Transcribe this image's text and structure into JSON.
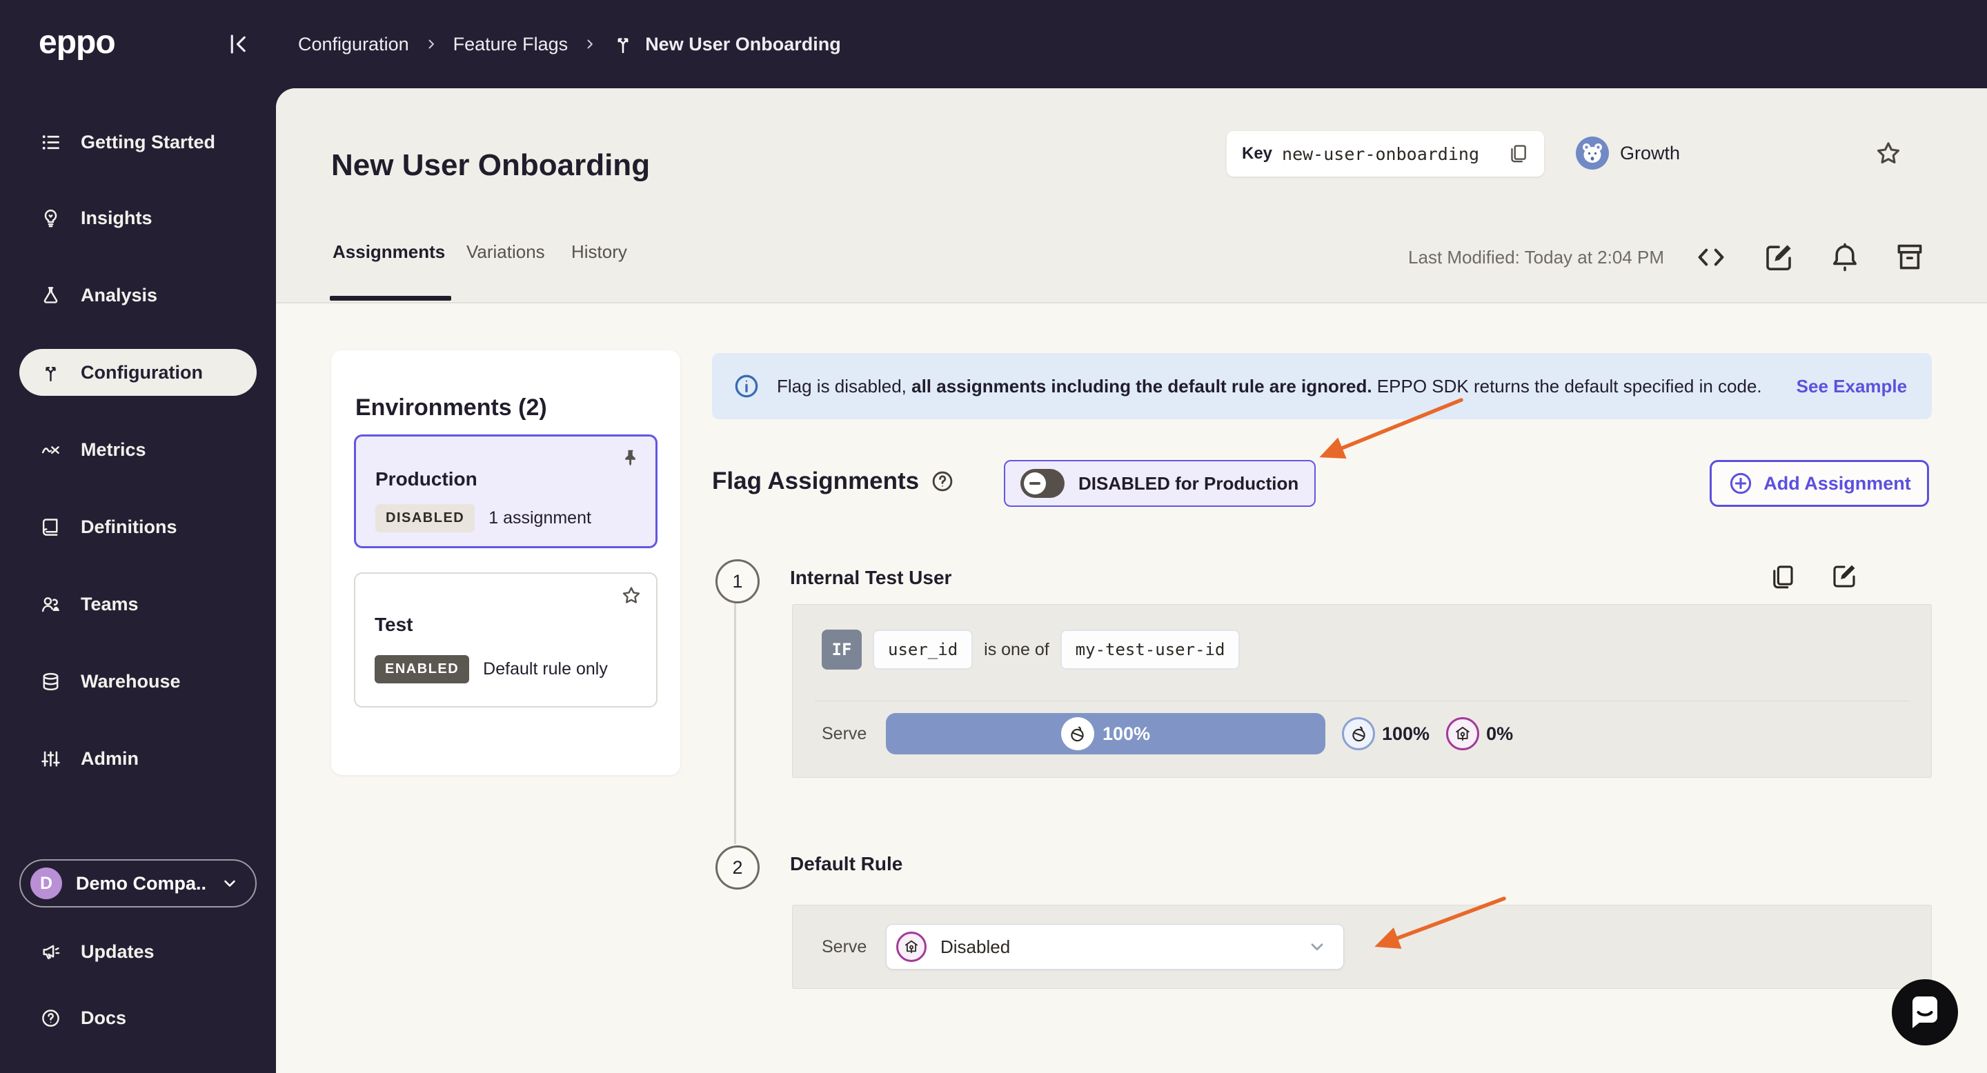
{
  "app": {
    "logo_text": "eppo"
  },
  "breadcrumb": {
    "items": [
      "Configuration",
      "Feature Flags",
      "New User Onboarding"
    ]
  },
  "sidebar": {
    "items": [
      {
        "label": "Getting Started",
        "icon": "list-icon"
      },
      {
        "label": "Insights",
        "icon": "lightbulb-icon"
      },
      {
        "label": "Analysis",
        "icon": "flask-icon"
      },
      {
        "label": "Configuration",
        "icon": "branch-icon",
        "selected": true
      },
      {
        "label": "Metrics",
        "icon": "metrics-icon"
      },
      {
        "label": "Definitions",
        "icon": "book-icon"
      },
      {
        "label": "Teams",
        "icon": "people-icon"
      },
      {
        "label": "Warehouse",
        "icon": "database-icon"
      },
      {
        "label": "Admin",
        "icon": "sliders-icon"
      }
    ],
    "org": {
      "avatar_initial": "D",
      "name": "Demo Compa..."
    },
    "footer_items": [
      {
        "label": "Updates",
        "icon": "megaphone-icon"
      },
      {
        "label": "Docs",
        "icon": "help-icon"
      }
    ]
  },
  "header": {
    "title": "New User Onboarding",
    "key": {
      "label": "Key",
      "value": "new-user-onboarding"
    },
    "team": {
      "name": "Growth"
    },
    "tabs": [
      {
        "label": "Assignments",
        "active": true
      },
      {
        "label": "Variations"
      },
      {
        "label": "History"
      }
    ],
    "last_modified": "Last Modified: Today at 2:04 PM"
  },
  "environments": {
    "title": "Environments (2)",
    "cards": [
      {
        "name": "Production",
        "status": "DISABLED",
        "detail": "1 assignment",
        "pinned": true,
        "selected": true
      },
      {
        "name": "Test",
        "status": "ENABLED",
        "detail": "Default rule only"
      }
    ]
  },
  "banner": {
    "text_normal_1": "Flag is disabled, ",
    "text_bold": "all assignments including the default rule are ignored.",
    "text_normal_2": " EPPO SDK returns the default specified in code.",
    "link_label": "See Example"
  },
  "flag_assignments": {
    "heading": "Flag Assignments",
    "toggle_label": "DISABLED for Production",
    "add_button": "Add Assignment",
    "rules": [
      {
        "number": "1",
        "name": "Internal Test User",
        "condition": {
          "keyword": "IF",
          "attribute": "user_id",
          "operator": "is one of",
          "value": "my-test-user-id"
        },
        "serve_label": "Serve",
        "bar_label": "100%",
        "legend": [
          {
            "variation": "enabled-variation",
            "percent": "100%"
          },
          {
            "variation": "disabled-variation",
            "percent": "0%"
          }
        ]
      },
      {
        "number": "2",
        "name": "Default Rule",
        "serve_label": "Serve",
        "dropdown_value": "Disabled"
      }
    ]
  },
  "colors": {
    "sidebar_bg": "#251f33",
    "accent_purple": "#6456e0",
    "serve_bar_blue": "#8095c6",
    "arrow_orange": "#e8682a",
    "banner_bg": "#e1ebf8",
    "enabled_variation_ring": "#8ba3d4",
    "disabled_variation_ring": "#a23a98",
    "team_badge_blue": "#7189c4"
  }
}
